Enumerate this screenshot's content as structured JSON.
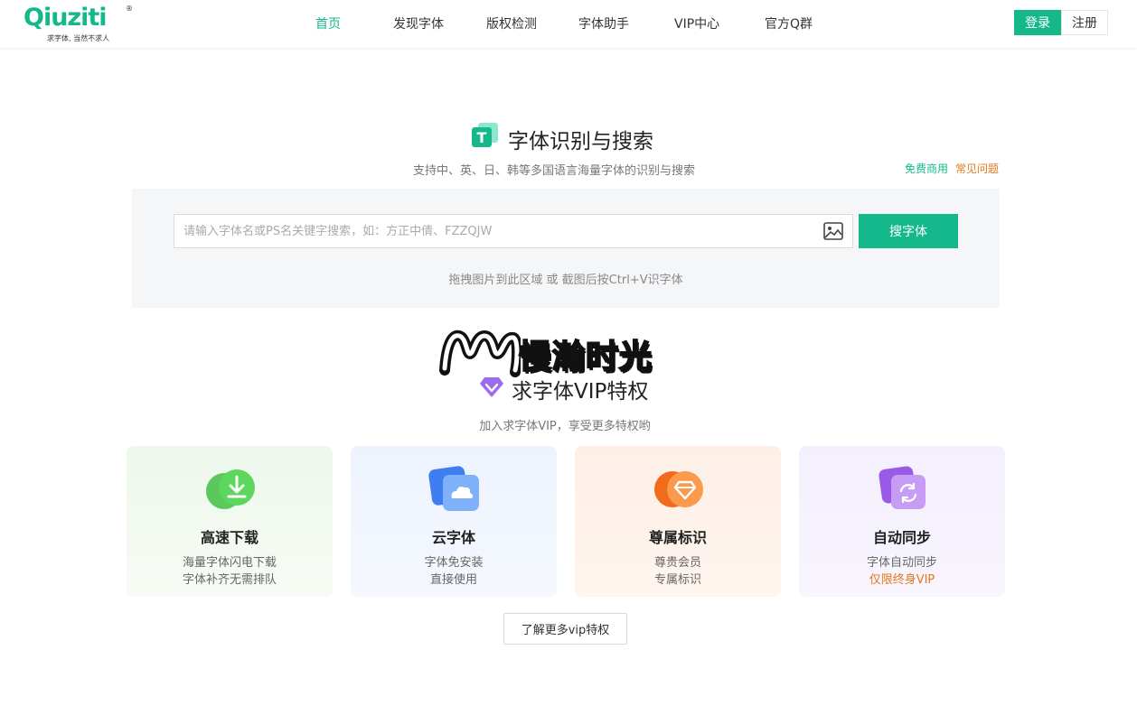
{
  "header": {
    "logo_text": "Qiuziti",
    "logo_reg": "®",
    "logo_slogan": "求字体, 当然不求人",
    "nav": [
      {
        "label": "首页",
        "active": true
      },
      {
        "label": "发现字体",
        "active": false
      },
      {
        "label": "版权检测",
        "active": false
      },
      {
        "label": "字体助手",
        "active": false
      },
      {
        "label": "VIP中心",
        "active": false
      },
      {
        "label": "官方Q群",
        "active": false
      }
    ],
    "login_label": "登录",
    "register_label": "注册"
  },
  "search_section": {
    "title": "字体识别与搜索",
    "subtitle": "支持中、英、日、韩等多国语言海量字体的识别与搜索",
    "link_free": "免费商用",
    "link_faq": "常见问题",
    "search_placeholder": "请输入字体名或PS名关键字搜索，如：方正中倩、FZZQJW",
    "search_value": "",
    "search_button": "搜字体",
    "drag_hint": "拖拽图片到此区域 或 截图后按Ctrl+V识字体",
    "icon_badge": "T"
  },
  "watermark": {
    "text": "慢瀚时光"
  },
  "vip_section": {
    "title": "求字体VIP特权",
    "subtitle": "加入求字体VIP，享受更多特权哟",
    "cards": [
      {
        "title": "高速下载",
        "line1": "海量字体闪电下载",
        "line2": "字体补齐无需排队",
        "icon": "download-icon"
      },
      {
        "title": "云字体",
        "line1": "字体免安装",
        "line2": "直接使用",
        "icon": "cloud-icon"
      },
      {
        "title": "尊属标识",
        "line1": "尊贵会员",
        "line2": "专属标识",
        "icon": "diamond-icon"
      },
      {
        "title": "自动同步",
        "line1": "字体自动同步",
        "line2": "仅限终身VIP",
        "icon": "sync-icon"
      }
    ],
    "more_button": "了解更多vip特权"
  },
  "colors": {
    "brand": "#14b88a",
    "accent_orange": "#e07a1f"
  }
}
